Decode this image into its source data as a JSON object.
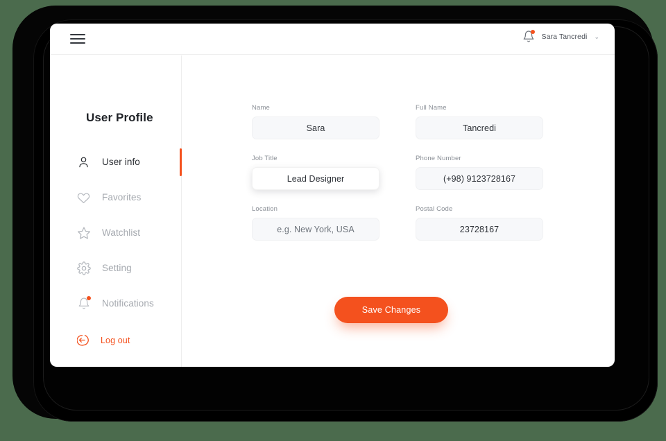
{
  "header": {
    "menu_icon": "hamburger-icon",
    "notification_icon": "bell-icon",
    "user_name": "Sara Tancredi",
    "chevron": "⌄"
  },
  "sidebar": {
    "title": "User Profile",
    "items": [
      {
        "label": "User info",
        "icon": "user-icon",
        "active": true
      },
      {
        "label": "Favorites",
        "icon": "heart-icon",
        "active": false
      },
      {
        "label": "Watchlist",
        "icon": "star-icon",
        "active": false
      },
      {
        "label": "Setting",
        "icon": "gear-icon",
        "active": false
      },
      {
        "label": "Notifications",
        "icon": "bell-icon",
        "active": false
      }
    ],
    "logout": {
      "label": "Log out",
      "icon": "logout-icon"
    }
  },
  "form": {
    "fields": [
      {
        "label": "Name",
        "value": "Sara",
        "is_placeholder": false,
        "focused": false
      },
      {
        "label": "Full Name",
        "value": "Tancredi",
        "is_placeholder": false,
        "focused": false
      },
      {
        "label": "Job Title",
        "value": "Lead Designer",
        "is_placeholder": false,
        "focused": true
      },
      {
        "label": "Phone Number",
        "value": "(+98) 9123728167",
        "is_placeholder": false,
        "focused": false
      },
      {
        "label": "Location",
        "value": "e.g. New York, USA",
        "is_placeholder": true,
        "focused": false
      },
      {
        "label": "Postal Code",
        "value": "23728167",
        "is_placeholder": false,
        "focused": false
      }
    ],
    "save_label": "Save Changes"
  },
  "colors": {
    "accent": "#f4511e",
    "background": "#4b6b4d",
    "card": "#ffffff",
    "field_fill": "#f7f8fa",
    "text_dark": "#2b2e33",
    "text_muted": "#a5a9af"
  }
}
